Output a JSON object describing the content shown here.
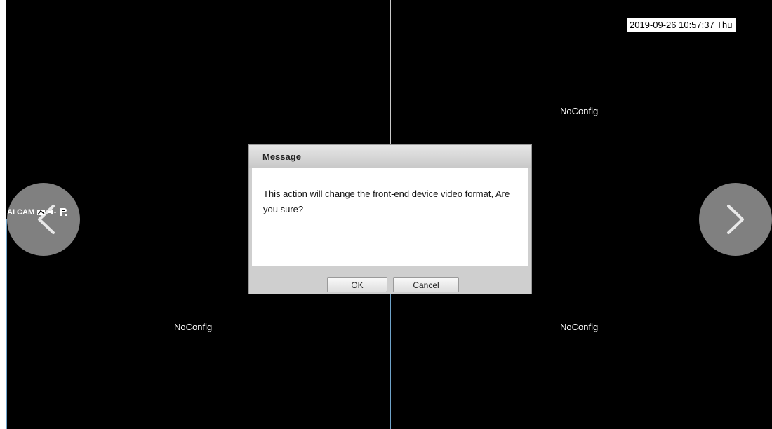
{
  "overlay": {
    "timestamp": "2019-09-26 10:57:37 Thu",
    "channel_status": "NoConfig",
    "camera_badge": "AI CAM"
  },
  "icons": {
    "prev": "chevron-left-icon",
    "next": "chevron-right-icon",
    "status": [
      "motion-icon",
      "audio-icon",
      "playback-icon"
    ]
  },
  "dialog": {
    "title": "Message",
    "message": "This action will change the front-end device video format, Are you sure?",
    "ok_label": "OK",
    "cancel_label": "Cancel"
  },
  "colors": {
    "background": "#000000",
    "grid_line": "#c9c9c9",
    "selected_line": "#6fa3c9",
    "nav_circle": "#969696"
  }
}
